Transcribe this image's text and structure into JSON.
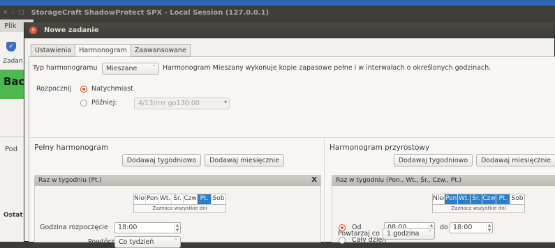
{
  "main_window": {
    "title": "StorageCraft ShadowProtect SPX - Local Session (127.0.0.1)",
    "controls": [
      "×",
      "–",
      "□"
    ]
  },
  "background": {
    "menu_plik": "Plik",
    "zadan": "Zadan",
    "bac": "Back",
    "pod": "Pod",
    "ostat": "Ostat"
  },
  "dialog": {
    "title": "Nowe zadanie",
    "tabs": [
      "Ustawienia",
      "Harmonogram",
      "Zaawansowane"
    ],
    "active_tab": "Harmonogram",
    "schedule_type": {
      "label": "Typ harmonogramu",
      "value": "Mieszane",
      "description": "Harmonogram Mieszany wykonuje kopie zapasowe pełne i w interwałach o określonych godzinach."
    },
    "start": {
      "label": "Rozpocznij",
      "now_label": "Natychmiast",
      "later_label": "Później:",
      "later_value": "4/13/rrrr go130:00",
      "selected": "Natychmiast"
    },
    "full": {
      "title": "Pełny harmonogram",
      "weekly_button": "Dodawaj tygodniowo",
      "monthly_button": "Dodawaj miesięcznie",
      "entry_title": "Raz w tygodniu (Pt.)",
      "close": "X",
      "days": [
        {
          "label": "Nied",
          "selected": false
        },
        {
          "label": "Pon",
          "selected": false
        },
        {
          "label": "Wt.",
          "selected": false
        },
        {
          "label": "Śr.",
          "selected": false
        },
        {
          "label": "Czw",
          "selected": false
        },
        {
          "label": "Pt.",
          "selected": true
        },
        {
          "label": "Sob",
          "selected": false
        }
      ],
      "select_all": "Zaznacz wszystkie dni",
      "start_time_label": "Godzina rozpoczęcie",
      "start_time": "18:00",
      "repeat_label": "Powtórz",
      "repeat_value": "Co tydzień"
    },
    "incremental": {
      "title": "Harmonogram przyrostowy",
      "weekly_button": "Dodawaj tygodniowo",
      "monthly_button": "Dodawaj miesięcznie",
      "entry_title": "Raz w tygodniu (Pon., Wt., Śr., Czw., Pt.)",
      "days": [
        {
          "label": "Nied",
          "selected": false
        },
        {
          "label": "Pon",
          "selected": true
        },
        {
          "label": "Wt.",
          "selected": true
        },
        {
          "label": "Śr.",
          "selected": true
        },
        {
          "label": "Czw",
          "selected": true
        },
        {
          "label": "Pt.",
          "selected": true
        },
        {
          "label": "Sob",
          "selected": false
        }
      ],
      "select_all": "Zaznacz wszystkie dni",
      "from_label": "Od",
      "from_value": "08:00",
      "to_label": "do",
      "to_value": "18:00",
      "all_day_label": "Cały dzień",
      "repeat_label": "Powtarzaj co",
      "repeat_value": "1 godzina"
    }
  },
  "colors": {
    "accent": "#2c7fc6",
    "radio": "#e0531d",
    "titlebar": "#3c3b37"
  }
}
